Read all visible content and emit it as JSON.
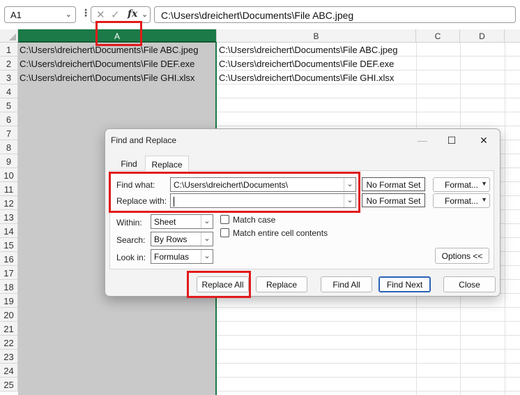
{
  "formula_bar": {
    "name_box": "A1",
    "formula": "C:\\Users\\dreichert\\Documents\\File ABC.jpeg",
    "fx_label": "fx"
  },
  "columns": [
    "A",
    "B",
    "C",
    "D"
  ],
  "rows": [
    "1",
    "2",
    "3",
    "4",
    "5",
    "6",
    "7",
    "8",
    "9",
    "10",
    "11",
    "12",
    "13",
    "14",
    "15",
    "16",
    "17",
    "18",
    "19",
    "20",
    "21",
    "22",
    "23",
    "24",
    "25"
  ],
  "cells": {
    "A1": "C:\\Users\\dreichert\\Documents\\File ABC.jpeg",
    "A2": "C:\\Users\\dreichert\\Documents\\File DEF.exe",
    "A3": "C:\\Users\\dreichert\\Documents\\File GHI.xlsx",
    "B1": "C:\\Users\\dreichert\\Documents\\File ABC.jpeg",
    "B2": "C:\\Users\\dreichert\\Documents\\File DEF.exe",
    "B3": "C:\\Users\\dreichert\\Documents\\File GHI.xlsx"
  },
  "dialog": {
    "title": "Find and Replace",
    "tabs": [
      {
        "label": "Find"
      },
      {
        "label": "Replace"
      }
    ],
    "find_what_label": "Find what:",
    "find_what_value": "C:\\Users\\dreichert\\Documents\\",
    "replace_with_label": "Replace with:",
    "replace_with_value": "",
    "no_format_label": "No Format Set",
    "format_label": "Format...",
    "within_label": "Within:",
    "within_value": "Sheet",
    "search_label": "Search:",
    "search_value": "By Rows",
    "lookin_label": "Look in:",
    "lookin_value": "Formulas",
    "match_case_label": "Match case",
    "match_entire_label": "Match entire cell contents",
    "options_label": "Options <<",
    "buttons": {
      "replace_all": "Replace All",
      "replace": "Replace",
      "find_all": "Find All",
      "find_next": "Find Next",
      "close": "Close"
    }
  },
  "colors": {
    "selection_green": "#1b7a47",
    "highlight_red": "#e11b1b",
    "default_button_blue": "#2a62b6"
  }
}
